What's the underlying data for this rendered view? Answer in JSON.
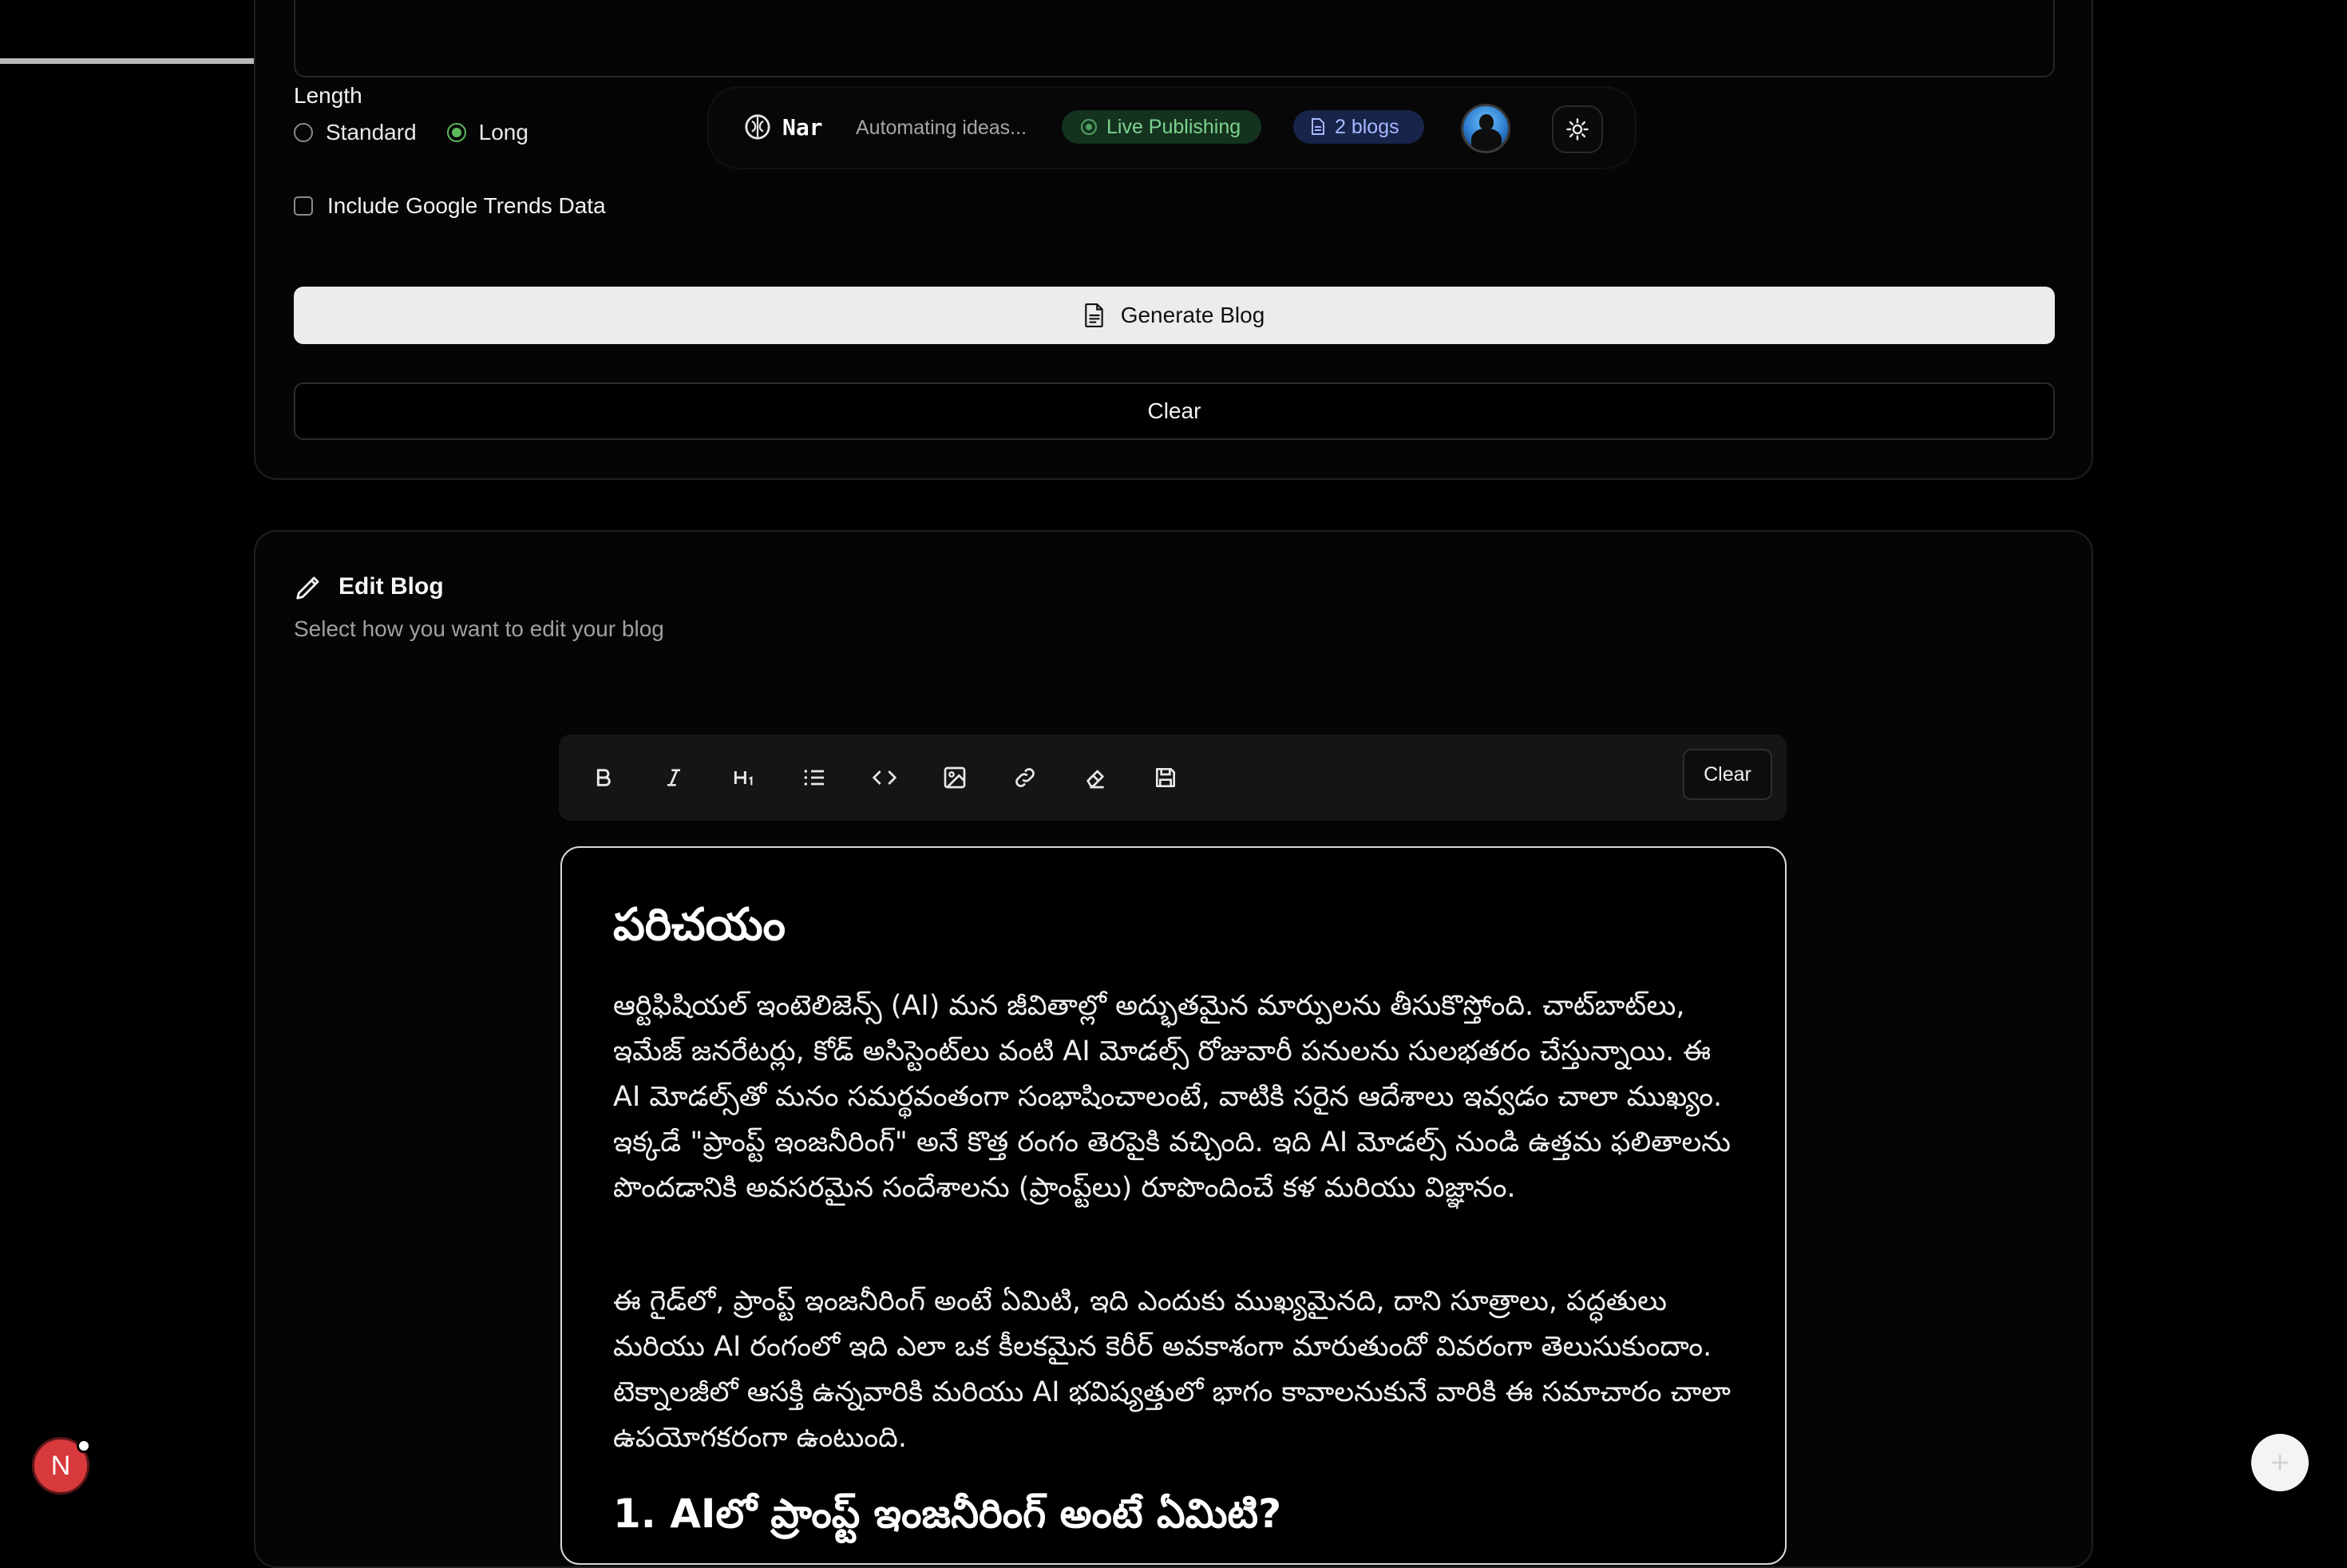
{
  "form": {
    "length_label": "Length",
    "length_options": [
      {
        "label": "Standard",
        "selected": false
      },
      {
        "label": "Long",
        "selected": true
      }
    ],
    "include_trends_label": "Include Google Trends Data",
    "include_trends_checked": false,
    "generate_button": "Generate Blog",
    "clear_button": "Clear"
  },
  "nav": {
    "brand_name": "Nar",
    "tagline": "Automating ideas...",
    "live_pill": "Live Publishing",
    "blogs_pill": "2 blogs",
    "brand_icon": "brain-icon",
    "theme_icon": "sun-icon"
  },
  "edit": {
    "title": "Edit Blog",
    "subtitle": "Select how you want to edit your blog",
    "toolbar": {
      "buttons": [
        "bold-icon",
        "italic-icon",
        "heading-icon",
        "list-icon",
        "code-icon",
        "image-icon",
        "link-icon",
        "eraser-icon",
        "save-icon"
      ],
      "clear_label": "Clear"
    }
  },
  "editor": {
    "heading": "పరిచయం",
    "paragraph1": "ఆర్టిఫిషియల్ ఇంటెలిజెన్స్ (AI) మన జీవితాల్లో అద్భుతమైన మార్పులను తీసుకొస్తోంది. చాట్‌బాట్‌లు, ఇమేజ్ జనరేటర్లు, కోడ్ అసిస్టెంట్‌లు వంటి AI మోడల్స్ రోజువారీ పనులను సులభతరం చేస్తున్నాయి. ఈ AI మోడల్స్‌తో మనం సమర్థవంతంగా సంభాషించాలంటే, వాటికి సరైన ఆదేశాలు ఇవ్వడం చాలా ముఖ్యం. ఇక్కడే \"ప్రాంప్ట్ ఇంజనీరింగ్\" అనే కొత్త రంగం తెరపైకి వచ్చింది. ఇది AI మోడల్స్ నుండి ఉత్తమ ఫలితాలను పొందడానికి అవసరమైన సందేశాలను (ప్రాంప్ట్‌లు) రూపొందించే కళ మరియు విజ్ఞానం.",
    "paragraph2": "ఈ గైడ్‌లో, ప్రాంప్ట్ ఇంజనీరింగ్ అంటే ఏమిటి, ఇది ఎందుకు ముఖ్యమైనది, దాని సూత్రాలు, పద్ధతులు మరియు AI రంగంలో ఇది ఎలా ఒక కీలకమైన కెరీర్ అవకాశంగా మారుతుందో వివరంగా తెలుసుకుందాం. టెక్నాలజీలో ఆసక్తి ఉన్నవారికి మరియు AI భవిష్యత్తులో భాగం కావాలనుకునే వారికి ఈ సమాచారం చాలా ఉపయోగకరంగా ఉంటుంది.",
    "heading2": "1. AIలో ప్రాంప్ట్ ఇంజనీరింగ్ అంటే ఏమిటి?"
  },
  "floating": {
    "badge_letter": "N",
    "fab_icon": "plus-icon"
  },
  "progress_fraction": 0.13,
  "colors": {
    "accent_green": "#5eb95e",
    "live_text": "#7fd28f",
    "blogs_text": "#a6b8ff",
    "badge_red": "#d8393c"
  }
}
